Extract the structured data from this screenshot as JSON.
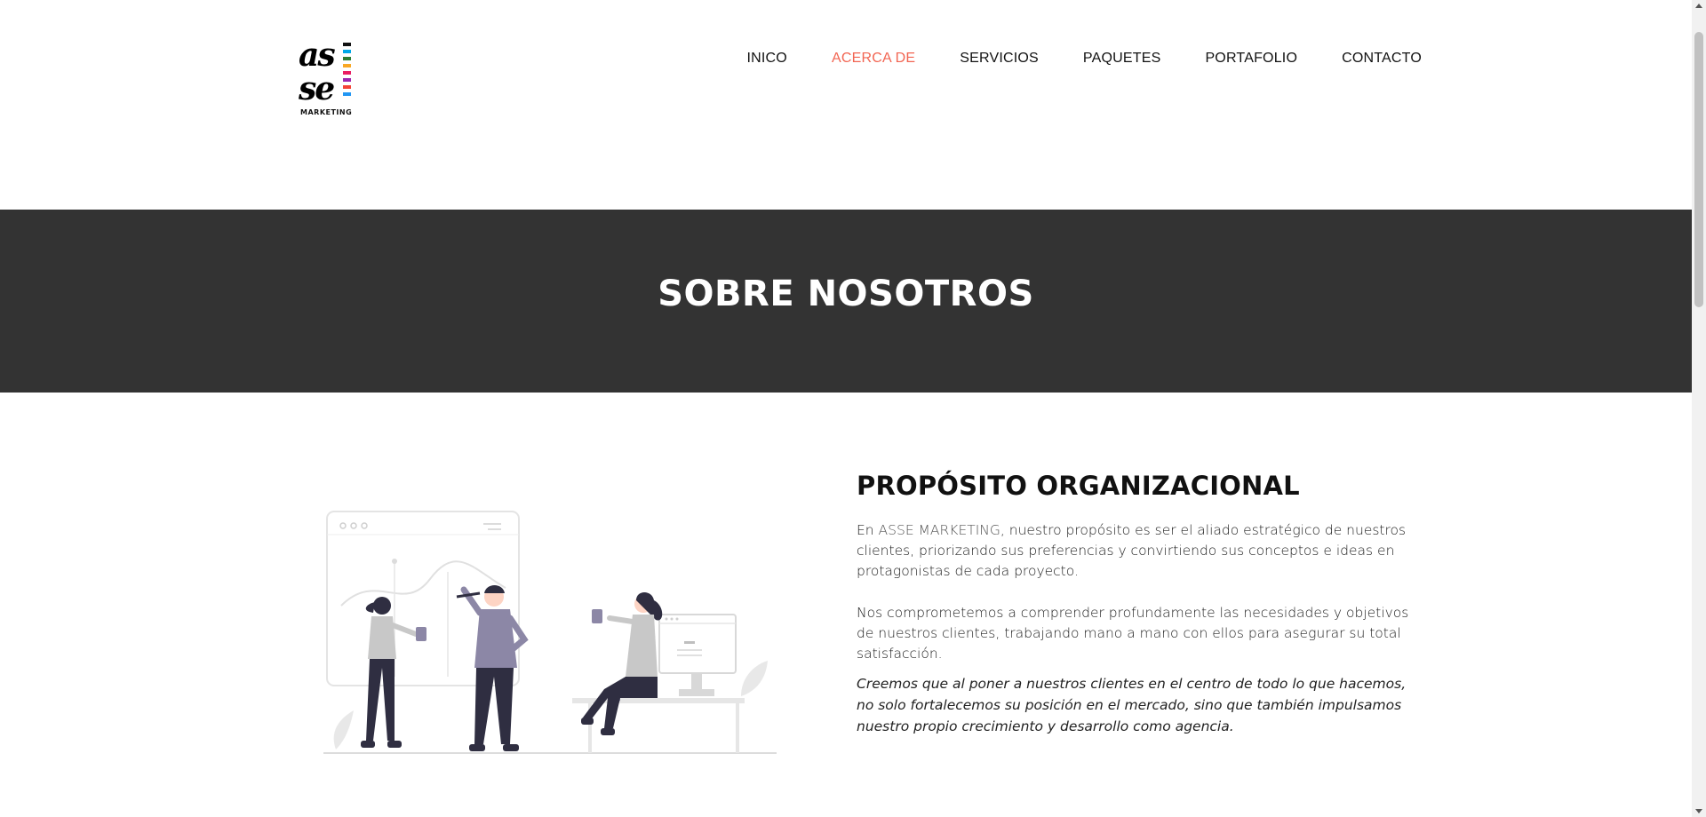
{
  "logo": {
    "line1": "as",
    "line2": "se",
    "subtitle": "MARKETING",
    "bar_colors": [
      "#111111",
      "#00a8e8",
      "#2e7d32",
      "#f9a825",
      "#e91e63",
      "#9c27b0",
      "#f44336",
      "#2196f3"
    ]
  },
  "nav": {
    "items": [
      {
        "label": "INICO",
        "active": false
      },
      {
        "label": "ACERCA DE",
        "active": true
      },
      {
        "label": "SERVICIOS",
        "active": false
      },
      {
        "label": "PAQUETES",
        "active": false
      },
      {
        "label": "PORTAFOLIO",
        "active": false
      },
      {
        "label": "CONTACTO",
        "active": false
      }
    ]
  },
  "banner": {
    "title": "SOBRE NOSOTROS"
  },
  "about": {
    "heading": "PROPÓSITO ORGANIZACIONAL",
    "p1_prefix": "En ",
    "p1_brand": "ASSE MARKETING",
    "p1_rest": ", nuestro propósito es ser el aliado estratégico de nuestros clientes, priorizando sus preferencias y convirtiendo sus conceptos e ideas en protagonistas de cada proyecto.",
    "p2": "Nos comprometemos a comprender profundamente las necesidades y objetivos de nuestros clientes, trabajando mano a mano con ellos para asegurar su total satisfacción.",
    "quote": "Creemos que al poner a nuestros clientes en el centro de todo lo que hacemos, no solo fortalecemos su posición en el mercado, sino que también impulsamos nuestro propio crecimiento y desarrollo como agencia."
  },
  "colors": {
    "accent": "#f26552",
    "banner_bg": "#333333",
    "illustration_purple": "#8c87a6",
    "illustration_dark": "#2f2e41"
  }
}
